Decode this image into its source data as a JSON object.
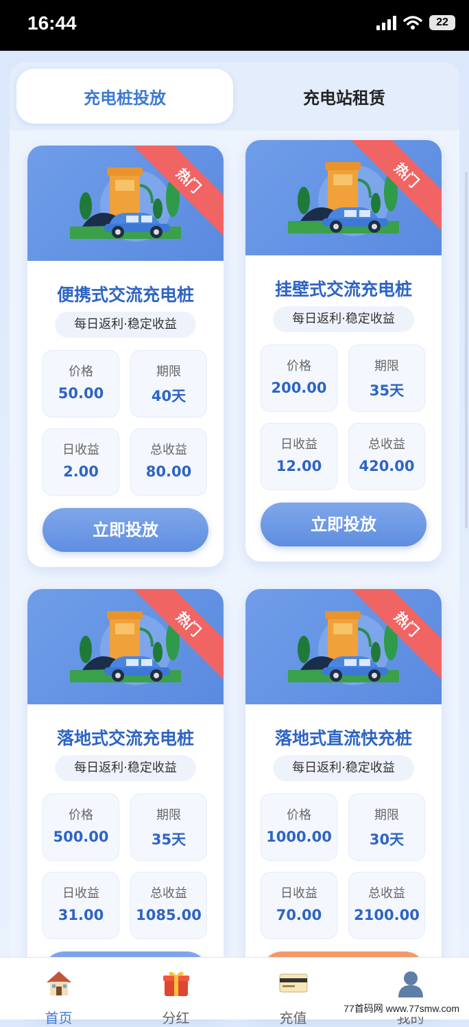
{
  "status": {
    "time": "16:44",
    "battery": "22"
  },
  "tabs": [
    {
      "label": "充电桩投放",
      "active": true
    },
    {
      "label": "充电站租赁",
      "active": false
    }
  ],
  "products": [
    {
      "title": "便携式交流充电桩",
      "tag": "每日返利·稳定收益",
      "badge": "热门",
      "price_label": "价格",
      "price": "50.00",
      "term_label": "期限",
      "term": "40天",
      "daily_label": "日收益",
      "daily": "2.00",
      "total_label": "总收益",
      "total": "80.00",
      "button": "立即投放"
    },
    {
      "title": "挂壁式交流充电桩",
      "tag": "每日返利·稳定收益",
      "badge": "热门",
      "price_label": "价格",
      "price": "200.00",
      "term_label": "期限",
      "term": "35天",
      "daily_label": "日收益",
      "daily": "12.00",
      "total_label": "总收益",
      "total": "420.00",
      "button": "立即投放"
    },
    {
      "title": "落地式交流充电桩",
      "tag": "每日返利·稳定收益",
      "badge": "热门",
      "price_label": "价格",
      "price": "500.00",
      "term_label": "期限",
      "term": "35天",
      "daily_label": "日收益",
      "daily": "31.00",
      "total_label": "总收益",
      "total": "1085.00",
      "button": ""
    },
    {
      "title": "落地式直流快充桩",
      "tag": "每日返利·稳定收益",
      "badge": "热门",
      "price_label": "价格",
      "price": "1000.00",
      "term_label": "期限",
      "term": "30天",
      "daily_label": "日收益",
      "daily": "70.00",
      "total_label": "总收益",
      "total": "2100.00",
      "button": ""
    }
  ],
  "nav": [
    {
      "label": "首页",
      "icon": "home-icon",
      "active": true
    },
    {
      "label": "分红",
      "icon": "gift-icon",
      "active": false
    },
    {
      "label": "充值",
      "icon": "card-icon",
      "active": false
    },
    {
      "label": "我的",
      "icon": "user-icon",
      "active": false
    }
  ],
  "watermark": "77首码网 www.77smw.com",
  "colors": {
    "accent": "#3c79d4",
    "badge": "#f06464",
    "button": "#6f98e4"
  }
}
